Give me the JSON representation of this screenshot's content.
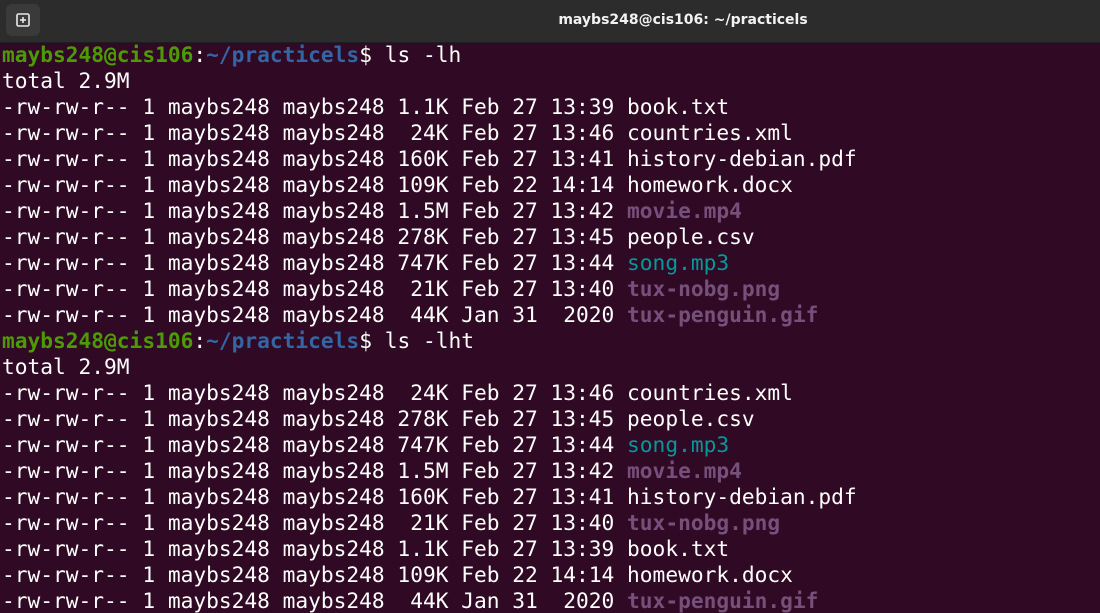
{
  "window": {
    "title": "maybs248@cis106: ~/practicels"
  },
  "colors": {
    "background": "#300a24",
    "titlebar": "#2c2c2c",
    "prompt_user": "#4e9a06",
    "prompt_path": "#3465a4",
    "media_file": "#75507b",
    "audio_file": "#06989a",
    "text": "#ffffff"
  },
  "icons": {
    "new_tab": "new-tab-icon"
  },
  "blocks": [
    {
      "prompt": {
        "user": "maybs248@cis106",
        "sep": ":",
        "path": "~/practicels",
        "symbol": "$ ",
        "command": "ls -lh"
      },
      "total": "total 2.9M",
      "rows": [
        {
          "info": "-rw-rw-r-- 1 maybs248 maybs248 1.1K Feb 27 13:39 ",
          "name": "book.txt",
          "kind": "plain"
        },
        {
          "info": "-rw-rw-r-- 1 maybs248 maybs248  24K Feb 27 13:46 ",
          "name": "countries.xml",
          "kind": "plain"
        },
        {
          "info": "-rw-rw-r-- 1 maybs248 maybs248 160K Feb 27 13:41 ",
          "name": "history-debian.pdf",
          "kind": "plain"
        },
        {
          "info": "-rw-rw-r-- 1 maybs248 maybs248 109K Feb 22 14:14 ",
          "name": "homework.docx",
          "kind": "plain"
        },
        {
          "info": "-rw-rw-r-- 1 maybs248 maybs248 1.5M Feb 27 13:42 ",
          "name": "movie.mp4",
          "kind": "media"
        },
        {
          "info": "-rw-rw-r-- 1 maybs248 maybs248 278K Feb 27 13:45 ",
          "name": "people.csv",
          "kind": "plain"
        },
        {
          "info": "-rw-rw-r-- 1 maybs248 maybs248 747K Feb 27 13:44 ",
          "name": "song.mp3",
          "kind": "audio"
        },
        {
          "info": "-rw-rw-r-- 1 maybs248 maybs248  21K Feb 27 13:40 ",
          "name": "tux-nobg.png",
          "kind": "media"
        },
        {
          "info": "-rw-rw-r-- 1 maybs248 maybs248  44K Jan 31  2020 ",
          "name": "tux-penguin.gif",
          "kind": "media"
        }
      ]
    },
    {
      "prompt": {
        "user": "maybs248@cis106",
        "sep": ":",
        "path": "~/practicels",
        "symbol": "$ ",
        "command": "ls -lht"
      },
      "total": "total 2.9M",
      "rows": [
        {
          "info": "-rw-rw-r-- 1 maybs248 maybs248  24K Feb 27 13:46 ",
          "name": "countries.xml",
          "kind": "plain"
        },
        {
          "info": "-rw-rw-r-- 1 maybs248 maybs248 278K Feb 27 13:45 ",
          "name": "people.csv",
          "kind": "plain"
        },
        {
          "info": "-rw-rw-r-- 1 maybs248 maybs248 747K Feb 27 13:44 ",
          "name": "song.mp3",
          "kind": "audio"
        },
        {
          "info": "-rw-rw-r-- 1 maybs248 maybs248 1.5M Feb 27 13:42 ",
          "name": "movie.mp4",
          "kind": "media"
        },
        {
          "info": "-rw-rw-r-- 1 maybs248 maybs248 160K Feb 27 13:41 ",
          "name": "history-debian.pdf",
          "kind": "plain"
        },
        {
          "info": "-rw-rw-r-- 1 maybs248 maybs248  21K Feb 27 13:40 ",
          "name": "tux-nobg.png",
          "kind": "media"
        },
        {
          "info": "-rw-rw-r-- 1 maybs248 maybs248 1.1K Feb 27 13:39 ",
          "name": "book.txt",
          "kind": "plain"
        },
        {
          "info": "-rw-rw-r-- 1 maybs248 maybs248 109K Feb 22 14:14 ",
          "name": "homework.docx",
          "kind": "plain"
        },
        {
          "info": "-rw-rw-r-- 1 maybs248 maybs248  44K Jan 31  2020 ",
          "name": "tux-penguin.gif",
          "kind": "media"
        }
      ]
    }
  ]
}
